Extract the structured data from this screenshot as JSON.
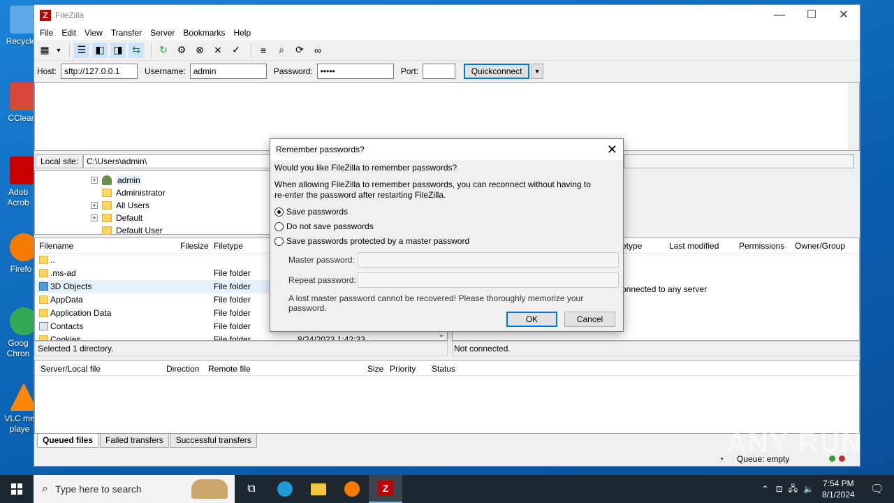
{
  "desktop": {
    "icons": [
      {
        "label": "Recycle",
        "color": "#5da9e9"
      },
      {
        "label": "CClear",
        "color": "#d8483a"
      },
      {
        "label": "Adob Acrob",
        "color": "#c90000"
      },
      {
        "label": "Firefo",
        "color": "#f57c00"
      },
      {
        "label": "Goog Chron",
        "color": "#34a853"
      },
      {
        "label": "VLC me playe",
        "color": "#ff8800"
      }
    ]
  },
  "window": {
    "title": "FileZilla",
    "app_icon_text": "Z",
    "controls": {
      "minimize": "—",
      "maximize": "☐",
      "close": "✕"
    }
  },
  "menu": [
    "File",
    "Edit",
    "View",
    "Transfer",
    "Server",
    "Bookmarks",
    "Help"
  ],
  "quickconnect": {
    "host_label": "Host:",
    "host_value": "sftp://127.0.0.1",
    "username_label": "Username:",
    "username_value": "admin",
    "password_label": "Password:",
    "password_value": "•••••",
    "port_label": "Port:",
    "port_value": "",
    "button": "Quickconnect",
    "dropdown": "▼"
  },
  "local_site": {
    "label": "Local site:",
    "path": "C:\\Users\\admin\\"
  },
  "tree": [
    {
      "label": "admin",
      "expander": "+",
      "user": true
    },
    {
      "label": "Administrator",
      "expander": ""
    },
    {
      "label": "All Users",
      "expander": "+"
    },
    {
      "label": "Default",
      "expander": "+"
    },
    {
      "label": "Default User",
      "expander": ""
    }
  ],
  "local_list": {
    "headers": {
      "filename": "Filename",
      "filesize": "Filesize",
      "filetype": "Filetype"
    },
    "rows": [
      {
        "name": "..",
        "type": ""
      },
      {
        "name": ".ms-ad",
        "type": "File folder"
      },
      {
        "name": "3D Objects",
        "type": "File folder"
      },
      {
        "name": "AppData",
        "type": "File folder"
      },
      {
        "name": "Application Data",
        "type": "File folder"
      },
      {
        "name": "Contacts",
        "type": "File folder"
      },
      {
        "name": "Cookies",
        "type": "File folder",
        "date": "8/24/2023 1:42:33"
      }
    ]
  },
  "remote_list": {
    "headers": {
      "filetype": "etype",
      "last_modified": "Last modified",
      "permissions": "Permissions",
      "owner": "Owner/Group"
    },
    "message": "onnected to any server"
  },
  "status": {
    "local": "Selected 1 directory.",
    "remote": "Not connected."
  },
  "queue": {
    "headers": {
      "server_file": "Server/Local file",
      "direction": "Direction",
      "remote_file": "Remote file",
      "size": "Size",
      "priority": "Priority",
      "status": "Status"
    },
    "tabs": [
      "Queued files",
      "Failed transfers",
      "Successful transfers"
    ],
    "queue_status": "Queue: empty"
  },
  "dialog": {
    "title": "Remember passwords?",
    "close": "✕",
    "question": "Would you like FileZilla to remember passwords?",
    "explanation": "When allowing FileZilla to remember passwords, you can reconnect without having to re-enter the password after restarting FileZilla.",
    "options": [
      {
        "label": "Save passwords",
        "selected": true
      },
      {
        "label": "Do not save passwords",
        "selected": false
      },
      {
        "label": "Save passwords protected by a master password",
        "selected": false
      }
    ],
    "master_password_label": "Master password:",
    "repeat_password_label": "Repeat password:",
    "warning": "A lost master password cannot be recovered! Please thoroughly memorize your password.",
    "ok": "OK",
    "cancel": "Cancel"
  },
  "taskbar": {
    "search_placeholder": "Type here to search",
    "time": "7:54 PM",
    "date": "8/1/2024"
  },
  "watermark": "ANY RUN"
}
